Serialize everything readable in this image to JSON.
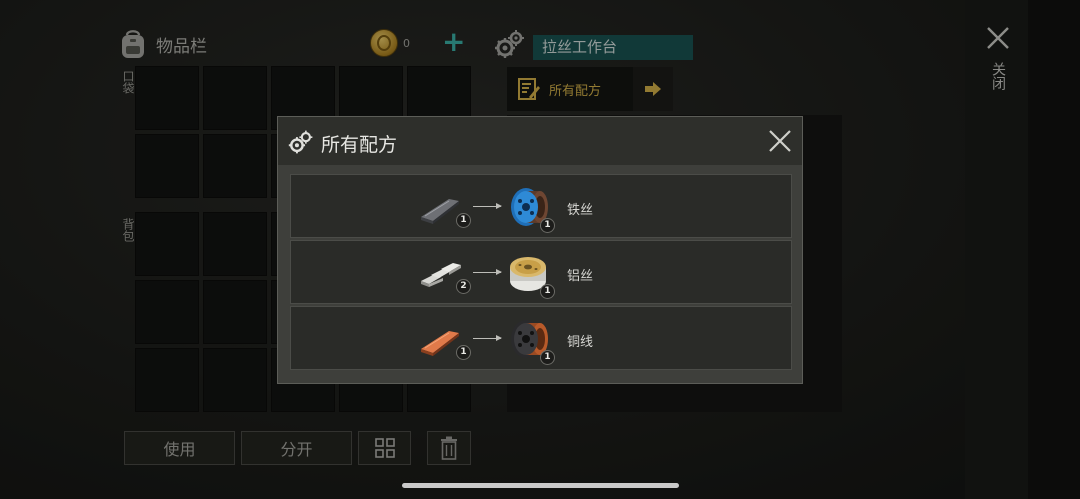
{
  "inventory": {
    "title": "物品栏",
    "pocket_label": "口袋",
    "backpack_label": "背包",
    "coins": "0"
  },
  "buttons": {
    "use": "使用",
    "split": "分开"
  },
  "workbench": {
    "title": "拉丝工作台",
    "recipes_tab": "所有配方"
  },
  "close_label": "关闭",
  "modal": {
    "title": "所有配方",
    "recipes": [
      {
        "input_icon": "iron-bar",
        "input_count": "1",
        "output_icon": "iron-wire-spool",
        "output_count": "1",
        "name": "铁丝"
      },
      {
        "input_icon": "aluminum-bars",
        "input_count": "2",
        "output_icon": "aluminum-wire-spool",
        "output_count": "1",
        "name": "铝丝"
      },
      {
        "input_icon": "copper-bar",
        "input_count": "1",
        "output_icon": "copper-wire-spool",
        "output_count": "1",
        "name": "铜线"
      }
    ]
  },
  "colors": {
    "accent_teal": "#1a5553",
    "accent_gold": "#d7b44a",
    "plus_teal": "#3bb3a8"
  }
}
